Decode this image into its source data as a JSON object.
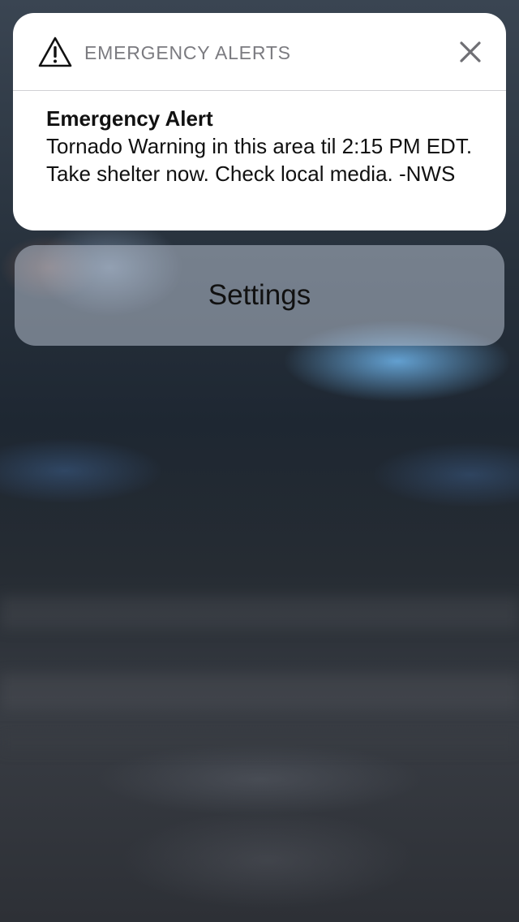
{
  "notification": {
    "app_name": "EMERGENCY ALERTS",
    "header_icon": "warning-triangle-icon",
    "close_icon": "close-icon",
    "title": "Emergency Alert",
    "message": "Tornado Warning in this area til 2:15 PM EDT. Take shelter now. Check local media. -NWS"
  },
  "actions": {
    "settings_label": "Settings"
  },
  "colors": {
    "card_background": "#ffffff",
    "header_text": "#7b7b80",
    "body_text": "#111111",
    "settings_background": "#a9b4c2"
  }
}
